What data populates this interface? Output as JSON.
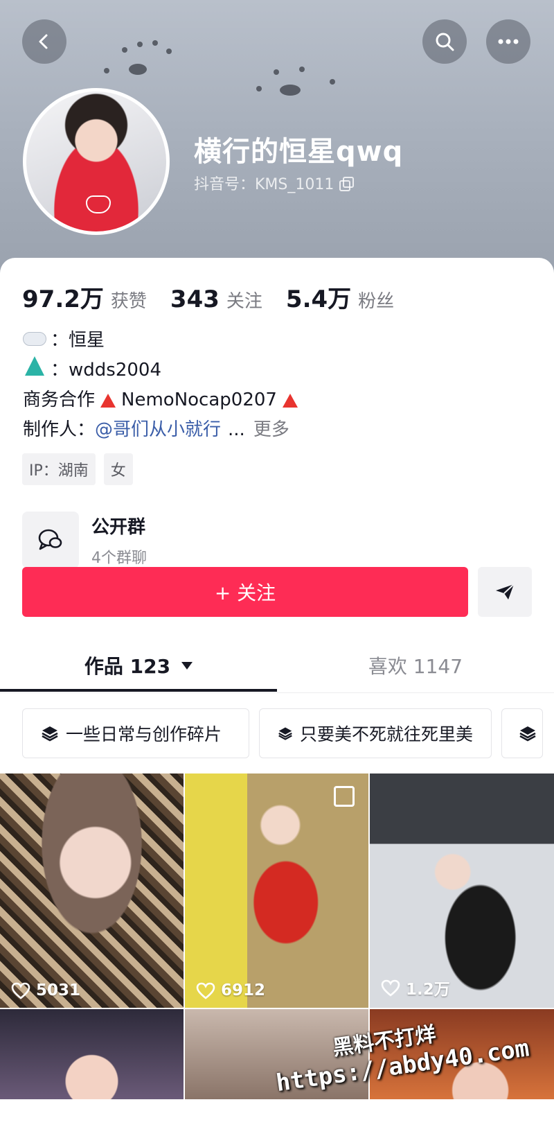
{
  "header": {
    "name": "横行的恒星qwq",
    "douyin_id": "抖音号：KMS_1011"
  },
  "stats": [
    {
      "value": "97.2万",
      "label": "获赞"
    },
    {
      "value": "343",
      "label": "关注"
    },
    {
      "value": "5.4万",
      "label": "粉丝"
    }
  ],
  "bio": {
    "line1": "：恒星",
    "line2": "：wdds2004",
    "line3_prefix": "商务合作",
    "line3_value": "NemoNocap0207",
    "line4_prefix": "制作人：",
    "line4_mention": "@哥们从小就行",
    "line4_ellipsis": "...",
    "more": "更多"
  },
  "tags": [
    "IP：湖南",
    "女"
  ],
  "group": {
    "title": "公开群",
    "subtitle": "4个群聊"
  },
  "follow_button": "+ 关注",
  "tabs": {
    "works": "作品 123",
    "likes": "喜欢 1147"
  },
  "collections": [
    "一些日常与创作碎片",
    "只要美不死就往死里美"
  ],
  "videos": [
    {
      "likes": "5031"
    },
    {
      "likes": "6912"
    },
    {
      "likes": "1.2万"
    }
  ],
  "watermark": {
    "line1": "黑料不打烊",
    "line2": "https://abdy40.com"
  },
  "colors": {
    "accent": "#fe2c55",
    "mention": "#3a5da8",
    "text": "#161823",
    "secondary": "#7a7b82"
  },
  "icons": [
    "back-icon",
    "search-icon",
    "more-icon",
    "copy-icon",
    "chat-icon",
    "share-icon",
    "layers-icon",
    "heart-icon"
  ]
}
